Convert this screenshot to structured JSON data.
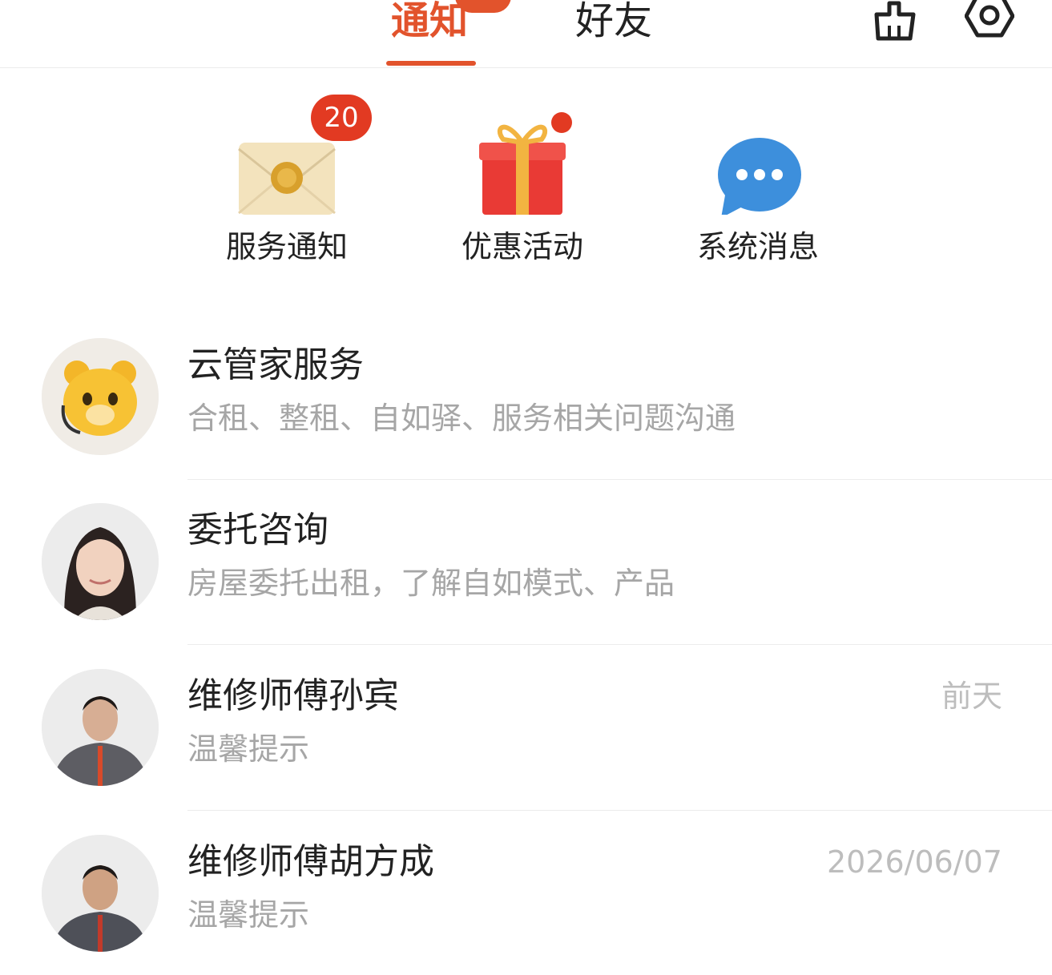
{
  "colors": {
    "accent": "#e2532c",
    "badge": "#e23a22",
    "text_primary": "#222222",
    "text_secondary": "#a6a6a6",
    "divider": "#ececec"
  },
  "header": {
    "tabs": [
      {
        "label": "通知",
        "active": true
      },
      {
        "label": "好友",
        "active": false
      }
    ],
    "icons": [
      "broom-icon",
      "gear-icon"
    ]
  },
  "categories": [
    {
      "label": "服务通知",
      "icon": "envelope-icon",
      "badge": "20"
    },
    {
      "label": "优惠活动",
      "icon": "gift-icon",
      "dot": true
    },
    {
      "label": "系统消息",
      "icon": "chat-bubble-icon"
    }
  ],
  "conversations": [
    {
      "name": "云管家服务",
      "subtitle": "合租、整租、自如驿、服务相关问题沟通",
      "time": "",
      "avatar": "bear-mascot-avatar"
    },
    {
      "name": "委托咨询",
      "subtitle": "房屋委托出租，了解自如模式、产品",
      "time": "",
      "avatar": "woman-avatar"
    },
    {
      "name": "维修师傅孙宾",
      "subtitle": "温馨提示",
      "time": "前天",
      "avatar": "man-avatar"
    },
    {
      "name": "维修师傅胡方成",
      "subtitle": "温馨提示",
      "time": "2026/06/07",
      "avatar": "man-avatar"
    }
  ]
}
